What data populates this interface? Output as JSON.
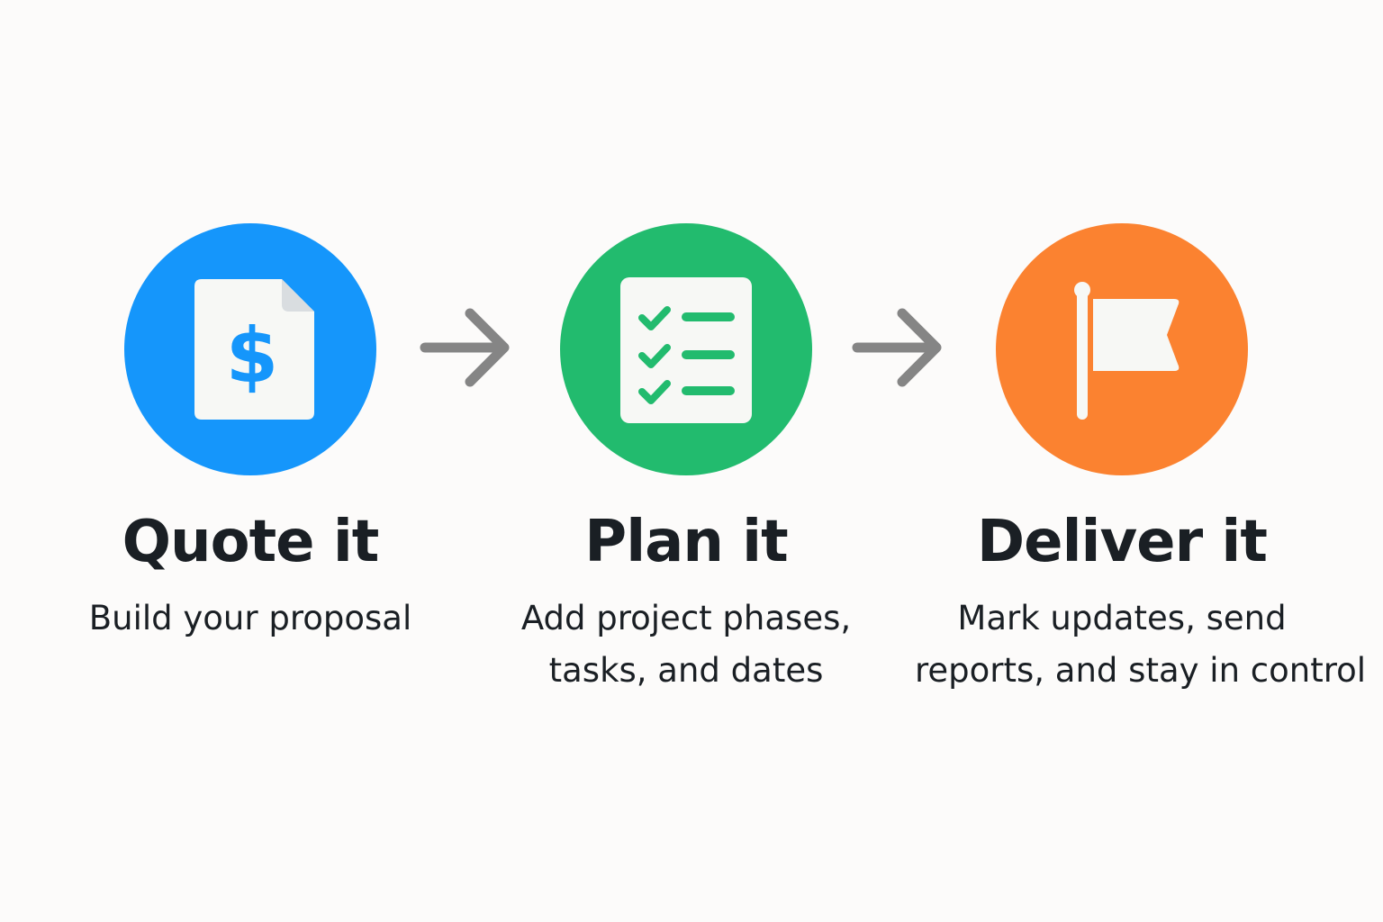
{
  "colors": {
    "quote": "#1596fb",
    "plan": "#22bb6e",
    "deliver": "#fb8230",
    "arrow": "#858585",
    "icon_bg": "#f7f8f5"
  },
  "steps": [
    {
      "title": "Quote it",
      "description": [
        "Build your proposal"
      ],
      "icon": "dollar-document-icon"
    },
    {
      "title": "Plan it",
      "description": [
        "Add project phases,",
        "tasks, and dates"
      ],
      "icon": "checklist-icon"
    },
    {
      "title": "Deliver it",
      "description": [
        "Mark updates, send",
        "reports, and stay in control"
      ],
      "icon": "flag-icon"
    }
  ],
  "arrows": [
    "arrow-right-icon",
    "arrow-right-icon"
  ]
}
